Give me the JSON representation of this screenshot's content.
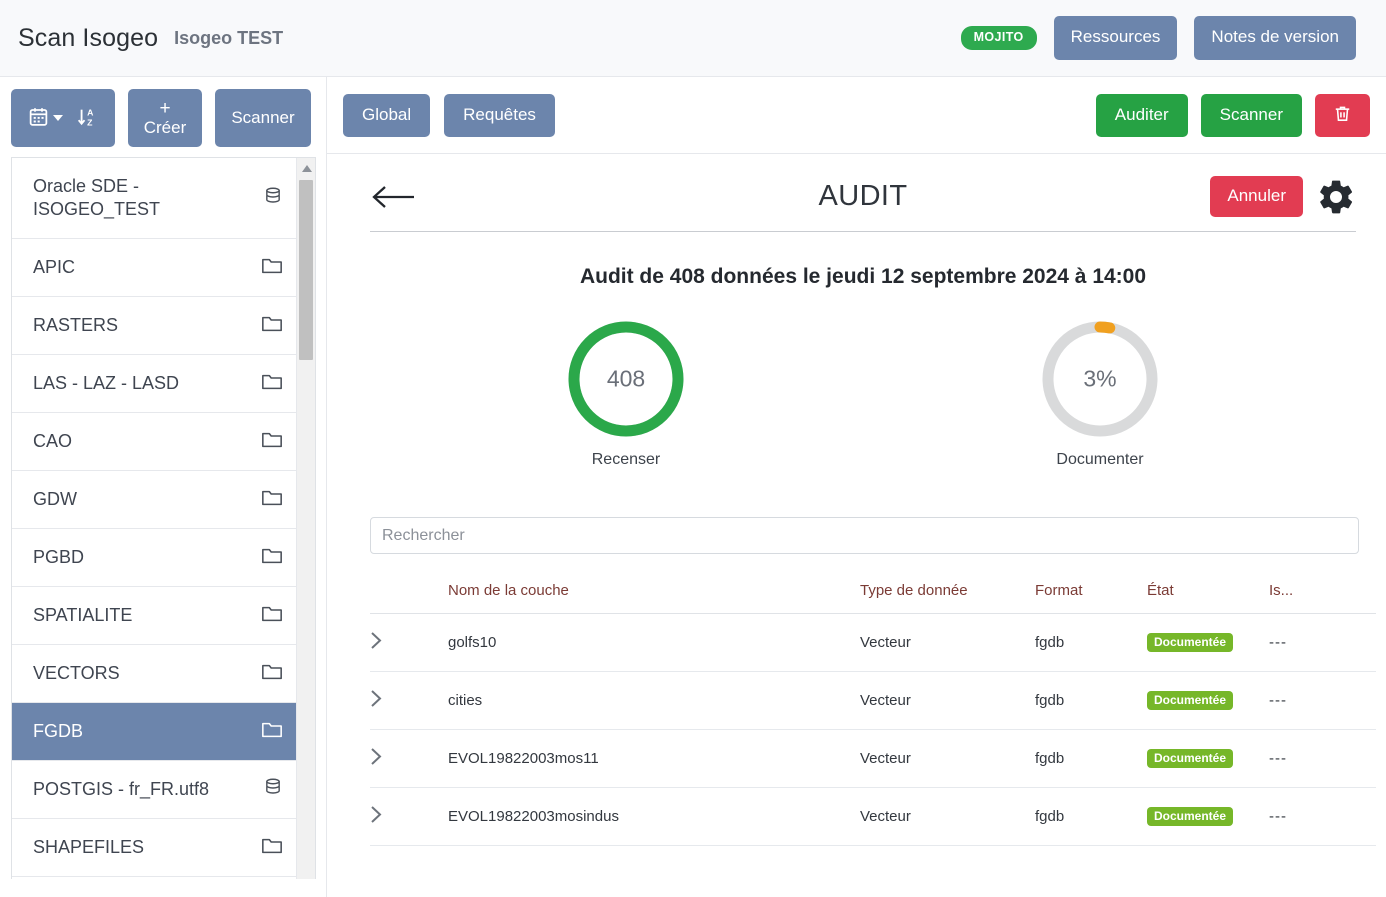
{
  "header": {
    "brand": "Scan Isogeo",
    "workgroup": "Isogeo TEST",
    "mojito_badge": "MOJITO",
    "resources_label": "Ressources",
    "release_notes_label": "Notes de version"
  },
  "left_toolbar": {
    "calendar_icon": "calendar-icon",
    "sort_icon": "sort-alpha-icon",
    "create_plus": "+",
    "create_label": "Créer",
    "scan_label": "Scanner"
  },
  "sidebar": {
    "items": [
      {
        "label": "Oracle SDE - ISOGEO_TEST",
        "icon": "database-icon",
        "selected": false,
        "two_line": true
      },
      {
        "label": "APIC",
        "icon": "folder-icon",
        "selected": false
      },
      {
        "label": "RASTERS",
        "icon": "folder-icon",
        "selected": false
      },
      {
        "label": "LAS - LAZ - LASD",
        "icon": "folder-icon",
        "selected": false
      },
      {
        "label": "CAO",
        "icon": "folder-icon",
        "selected": false
      },
      {
        "label": "GDW",
        "icon": "folder-icon",
        "selected": false
      },
      {
        "label": "PGBD",
        "icon": "folder-icon",
        "selected": false
      },
      {
        "label": "SPATIALITE",
        "icon": "folder-icon",
        "selected": false
      },
      {
        "label": "VECTORS",
        "icon": "folder-icon",
        "selected": false
      },
      {
        "label": "FGDB",
        "icon": "folder-icon",
        "selected": true
      },
      {
        "label": "POSTGIS - fr_FR.utf8",
        "icon": "database-icon",
        "selected": false
      },
      {
        "label": "SHAPEFILES",
        "icon": "folder-icon",
        "selected": false
      }
    ]
  },
  "main_toolbar": {
    "tabs": [
      {
        "label": "Global"
      },
      {
        "label": "Requêtes"
      }
    ],
    "audit_label": "Auditer",
    "scan_label": "Scanner",
    "delete_icon": "trash-icon"
  },
  "audit": {
    "back_icon": "arrow-left-icon",
    "title": "AUDIT",
    "cancel_label": "Annuler",
    "settings_icon": "gear-icon",
    "subtitle": "Audit de 408 données le jeudi 12 septembre 2024 à 14:00",
    "gauges": [
      {
        "value_text": "408",
        "caption": "Recenser",
        "percent": 100,
        "color": "#2ba84a",
        "track": "#d9dadb"
      },
      {
        "value_text": "3%",
        "caption": "Documenter",
        "percent": 3,
        "color": "#f0a020",
        "track": "#d9dadb"
      }
    ],
    "search_placeholder": "Rechercher",
    "search_value": "",
    "table": {
      "columns": [
        "",
        "Nom de la couche",
        "Type de donnée",
        "Format",
        "État",
        "Is..."
      ],
      "rows": [
        {
          "expand_icon": "chevron-right-icon",
          "name": "golfs10",
          "type": "Vecteur",
          "format": "fgdb",
          "state": "Documentée",
          "is": "---"
        },
        {
          "expand_icon": "chevron-right-icon",
          "name": "cities",
          "type": "Vecteur",
          "format": "fgdb",
          "state": "Documentée",
          "is": "---"
        },
        {
          "expand_icon": "chevron-right-icon",
          "name": "EVOL19822003mos11",
          "type": "Vecteur",
          "format": "fgdb",
          "state": "Documentée",
          "is": "---"
        },
        {
          "expand_icon": "chevron-right-icon",
          "name": "EVOL19822003mosindus",
          "type": "Vecteur",
          "format": "fgdb",
          "state": "Documentée",
          "is": "---"
        }
      ]
    }
  },
  "colors": {
    "slate": "#6c85ac",
    "green": "#26a244",
    "red": "#e23c52",
    "badge_green": "#76b729",
    "header_bg": "#f8f9fb",
    "mojito_green": "#2eaa4f",
    "table_header_text": "#7b3b35"
  }
}
